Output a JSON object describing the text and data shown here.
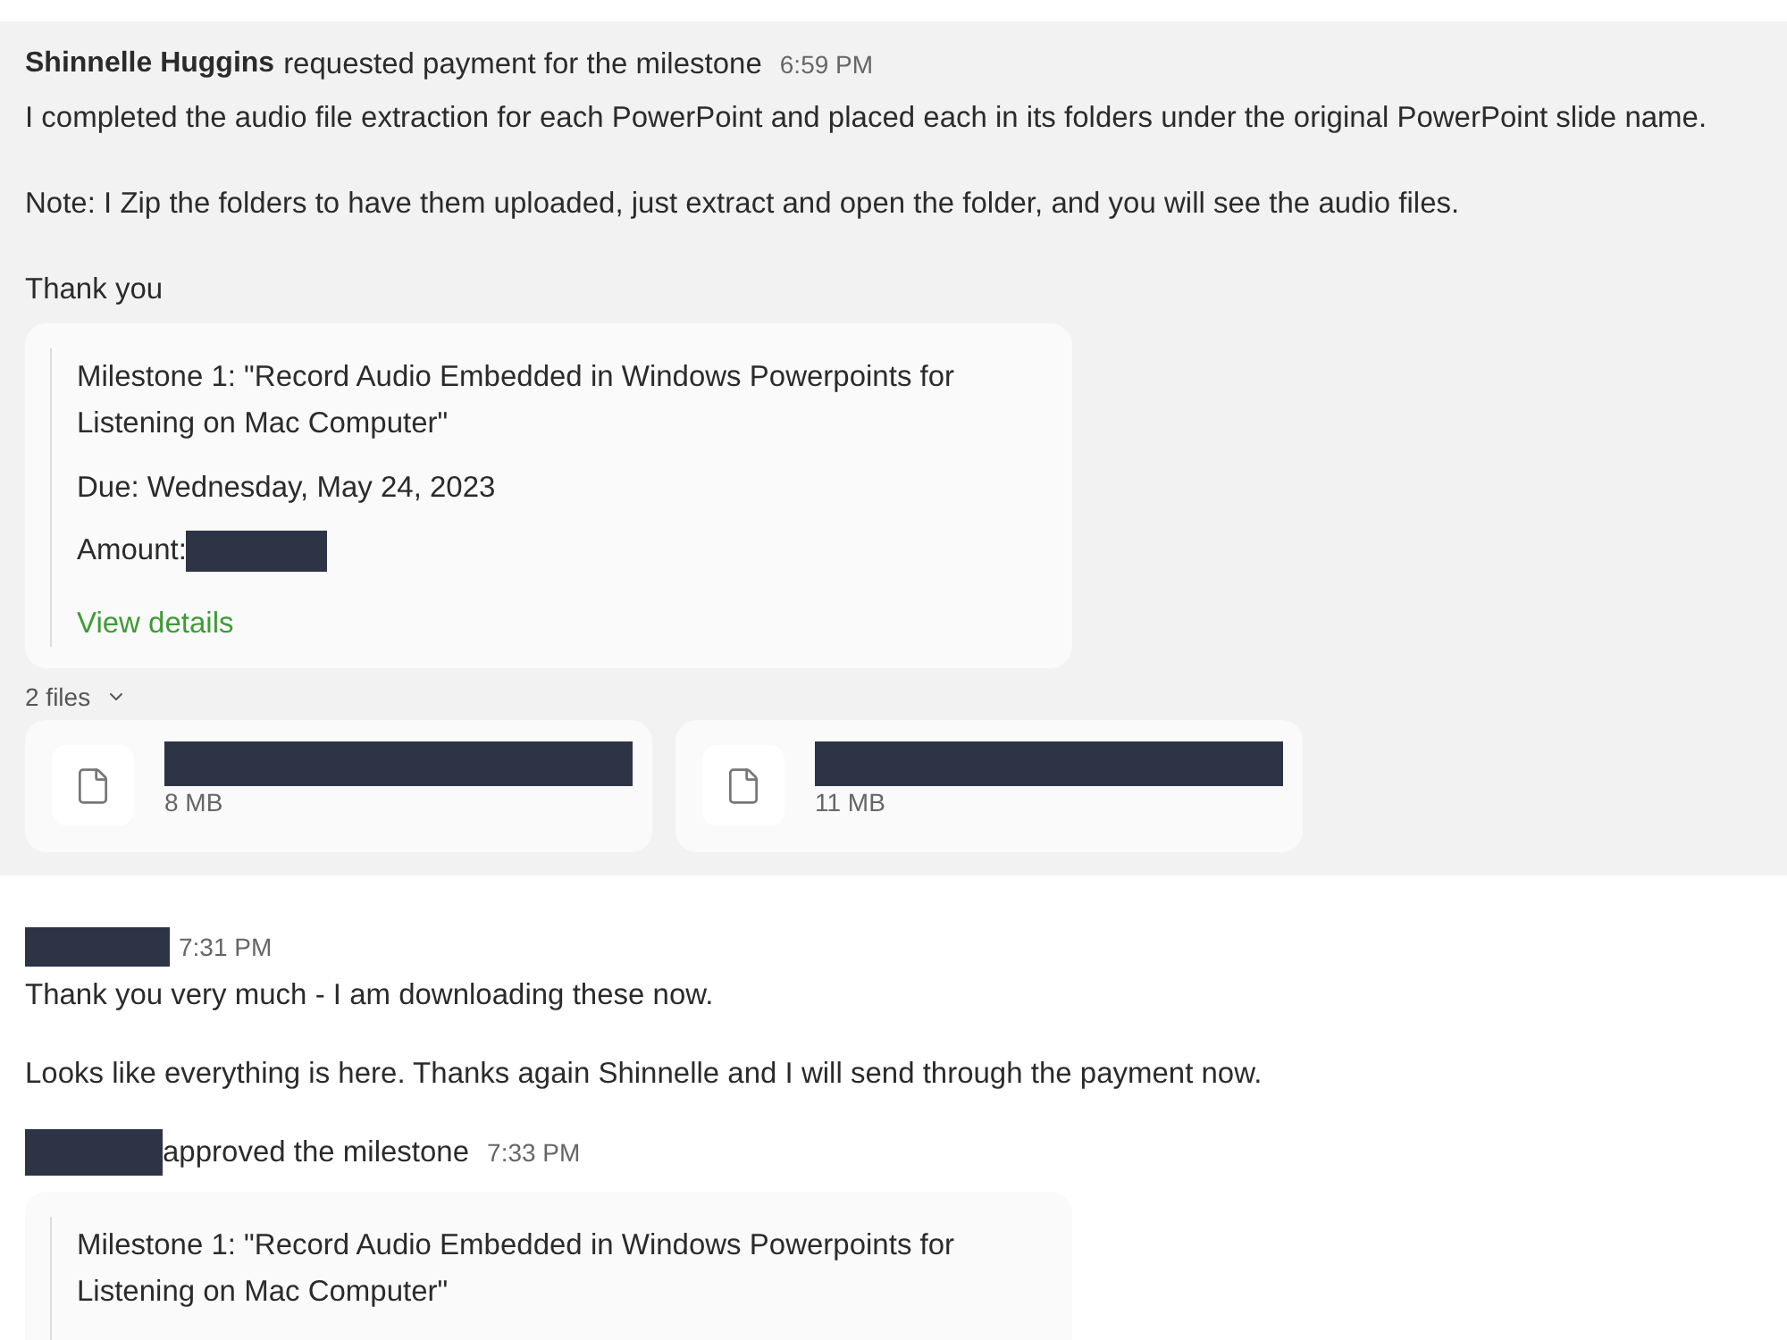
{
  "messages": [
    {
      "kind": "milestone_request",
      "highlighted": true,
      "sender": "Shinnelle Huggins",
      "action": "requested payment for the milestone",
      "time": "6:59 PM",
      "paragraphs": [
        "I completed the audio file extraction for each PowerPoint and placed each in its folders under the original PowerPoint slide name.",
        "Note: I Zip the folders to have them uploaded, just extract and open the folder, and you will see the audio files.",
        "Thank you"
      ],
      "milestone": {
        "title": "Milestone 1: \"Record Audio Embedded in Windows Powerpoints for Listening on Mac Computer\"",
        "due": "Due: Wednesday, May 24, 2023",
        "amount_label": "Amount:",
        "amount_redacted": true,
        "link": "View details"
      },
      "attachments": {
        "count": "2 files",
        "files": [
          {
            "name_redacted": true,
            "size": "8 MB"
          },
          {
            "name_redacted": true,
            "size": "11 MB"
          }
        ]
      }
    },
    {
      "kind": "message",
      "highlighted": false,
      "sender_redacted": true,
      "time": "7:31 PM",
      "paragraphs": [
        "Thank you very much - I am downloading these now.",
        "Looks like everything is here. Thanks again Shinnelle and I will send through the payment now."
      ]
    },
    {
      "kind": "milestone_approval",
      "highlighted": false,
      "sender_redacted": true,
      "action": "approved the milestone",
      "time": "7:33 PM",
      "milestone": {
        "title": "Milestone 1: \"Record Audio Embedded in Windows Powerpoints for Listening on Mac Computer\""
      }
    }
  ]
}
